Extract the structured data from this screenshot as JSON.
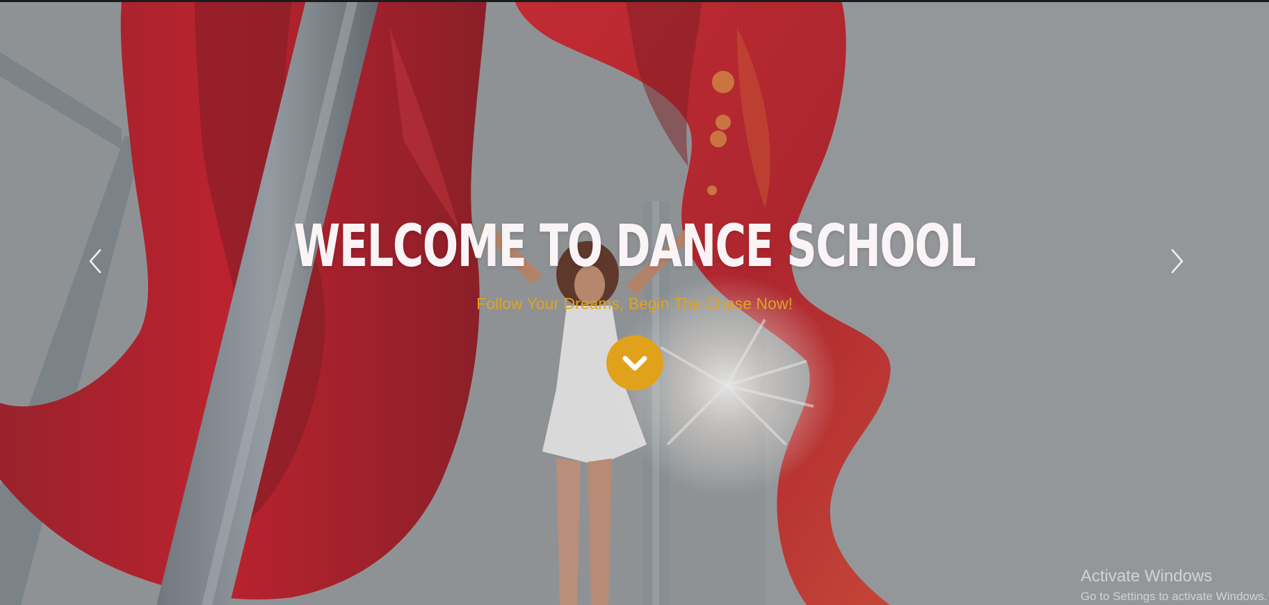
{
  "hero": {
    "headline": "WELCOME TO DANCE SCHOOL",
    "subheadline": "Follow Your Dreams, Begin The Chase Now!",
    "accent_color": "#e1a21b",
    "headline_color": "#fbf4f6",
    "scroll_icon": "chevron-down-icon",
    "prev_icon": "chevron-left-icon",
    "next_icon": "chevron-right-icon"
  },
  "os_watermark": {
    "title": "Activate Windows",
    "subtitle": "Go to Settings to activate Windows."
  }
}
